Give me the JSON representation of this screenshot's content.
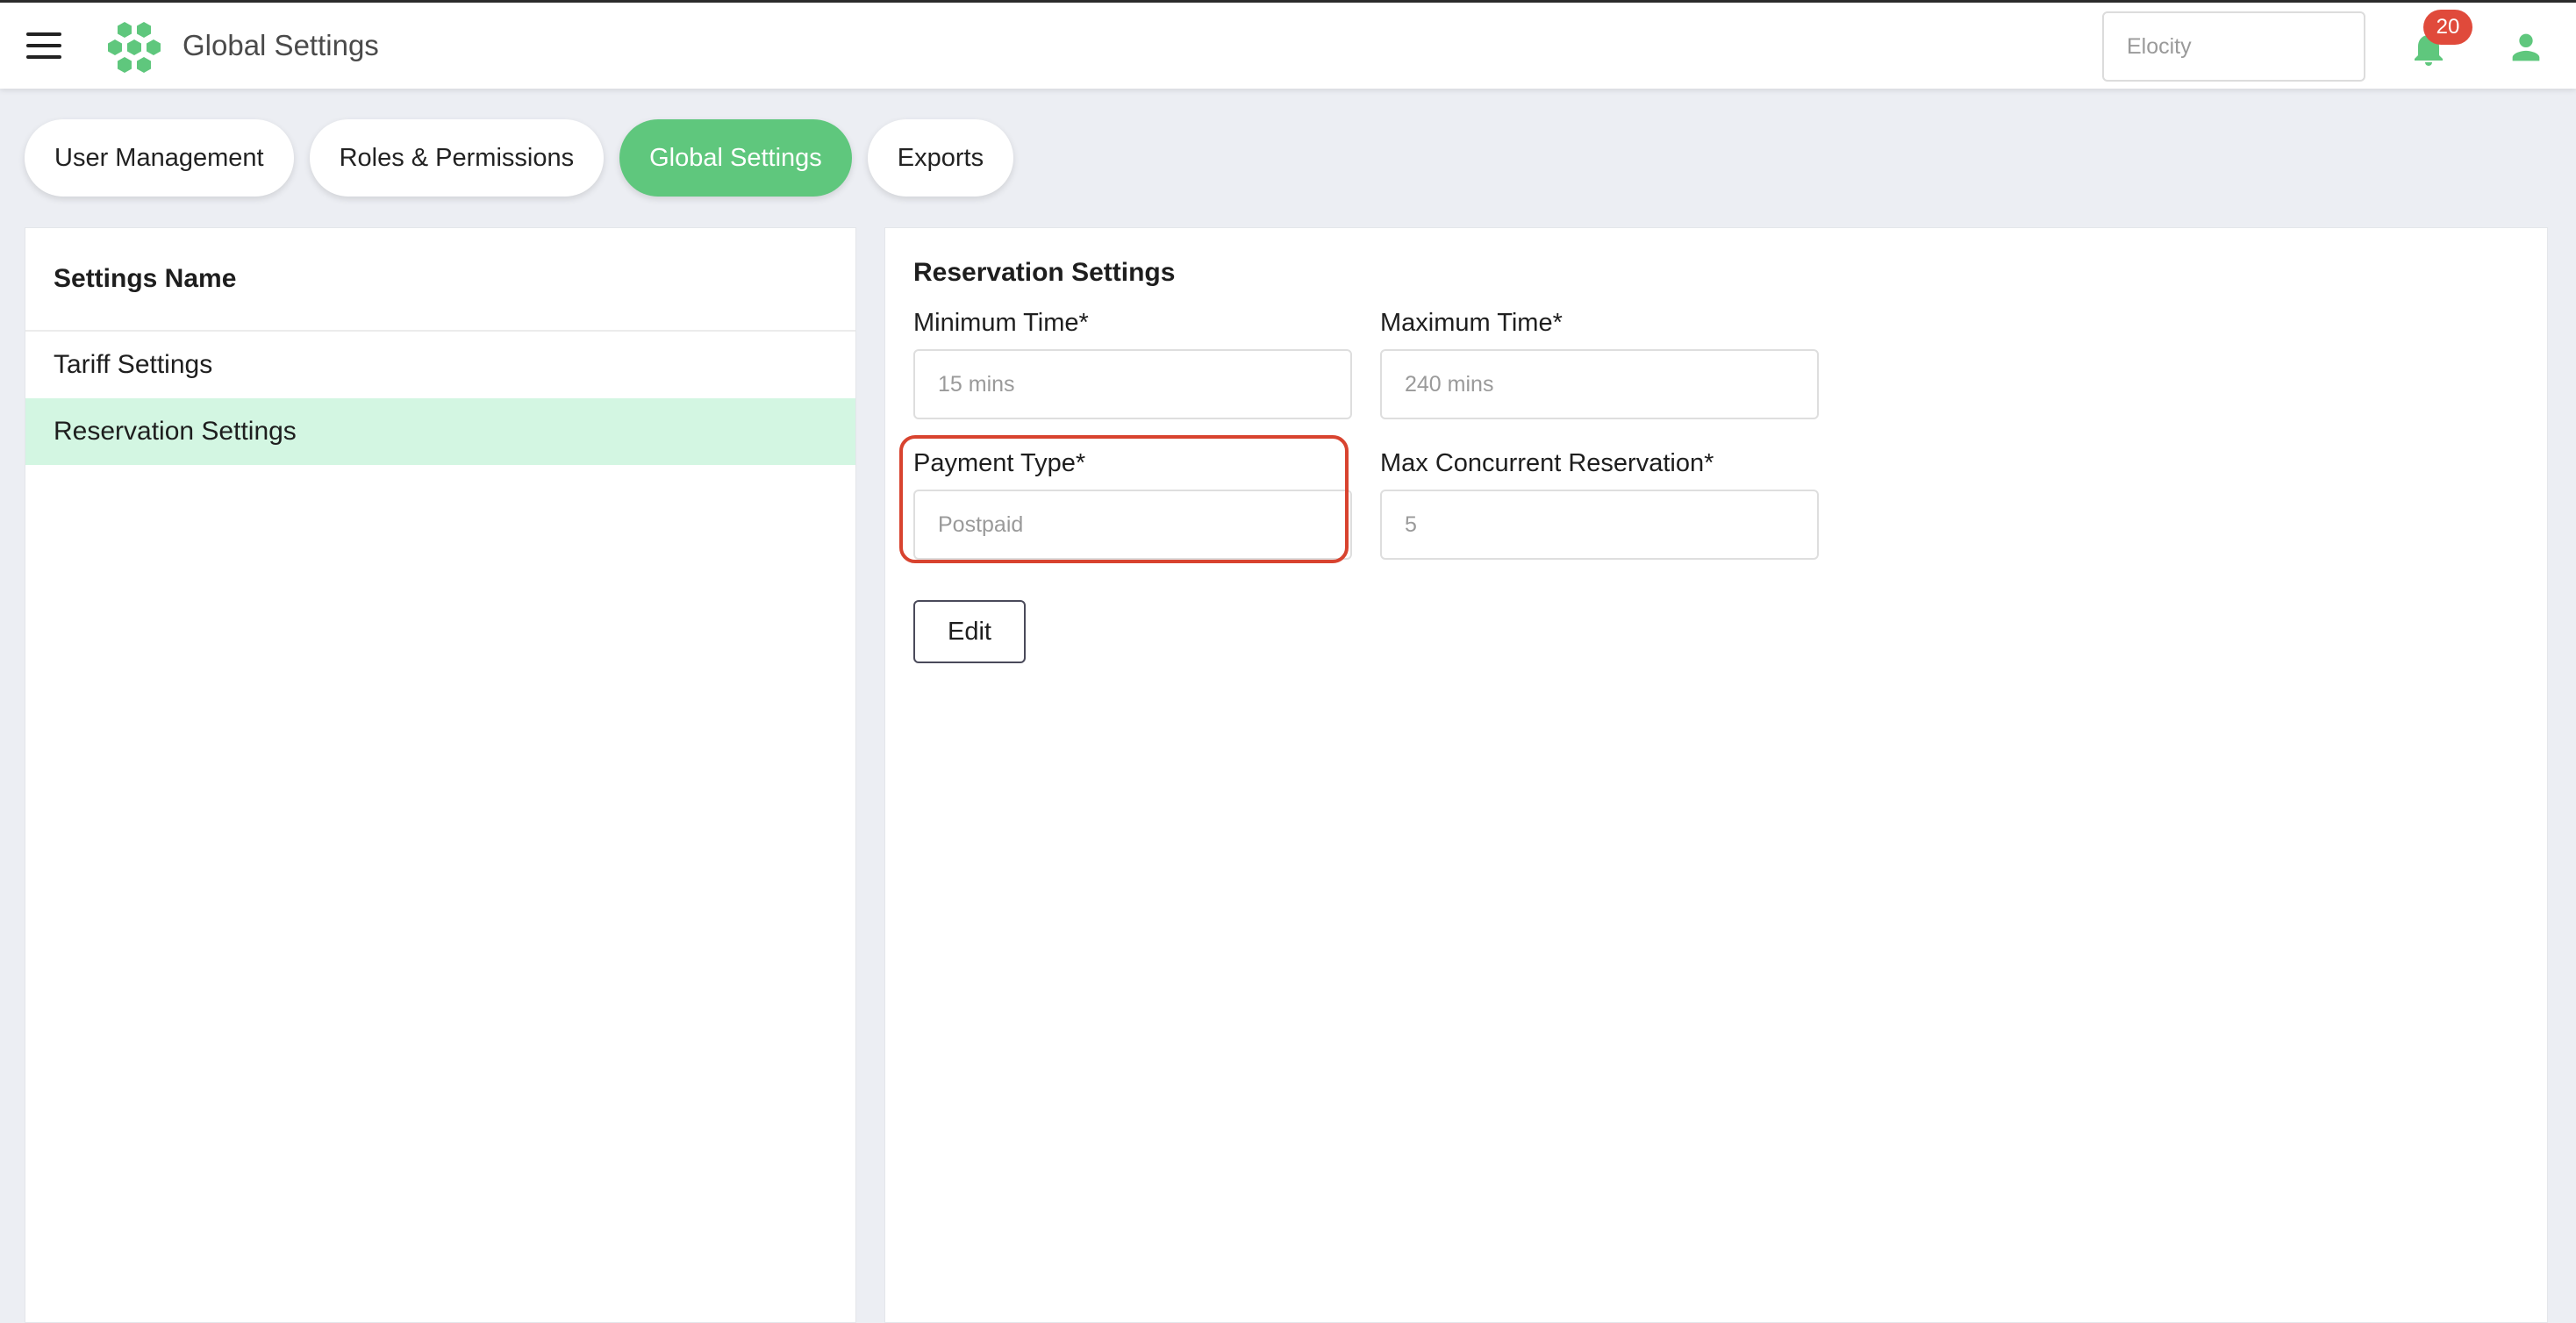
{
  "header": {
    "title": "Global Settings",
    "org_selector": "Elocity",
    "notification_count": "20",
    "icons": [
      "menu-icon",
      "logo-icon",
      "bell-icon",
      "user-icon"
    ]
  },
  "tabs": [
    {
      "label": "User Management",
      "active": false
    },
    {
      "label": "Roles & Permissions",
      "active": false
    },
    {
      "label": "Global Settings",
      "active": true
    },
    {
      "label": "Exports",
      "active": false
    }
  ],
  "settings_list": {
    "header": "Settings Name",
    "items": [
      {
        "label": "Tariff Settings",
        "selected": false
      },
      {
        "label": "Reservation Settings",
        "selected": true
      }
    ]
  },
  "reservation": {
    "title": "Reservation Settings",
    "min_time_label": "Minimum Time*",
    "min_time_placeholder": "15 mins",
    "max_time_label": "Maximum Time*",
    "max_time_placeholder": "240 mins",
    "payment_type_label": "Payment Type*",
    "payment_type_placeholder": "Postpaid",
    "max_concurrent_label": "Max Concurrent Reservation*",
    "max_concurrent_placeholder": "5",
    "edit_label": "Edit"
  },
  "colors": {
    "accent": "#5fc77d",
    "selected_row": "#d3f6e2",
    "badge": "#e04a3b",
    "highlight": "#d8432f",
    "background": "#eceef3"
  }
}
